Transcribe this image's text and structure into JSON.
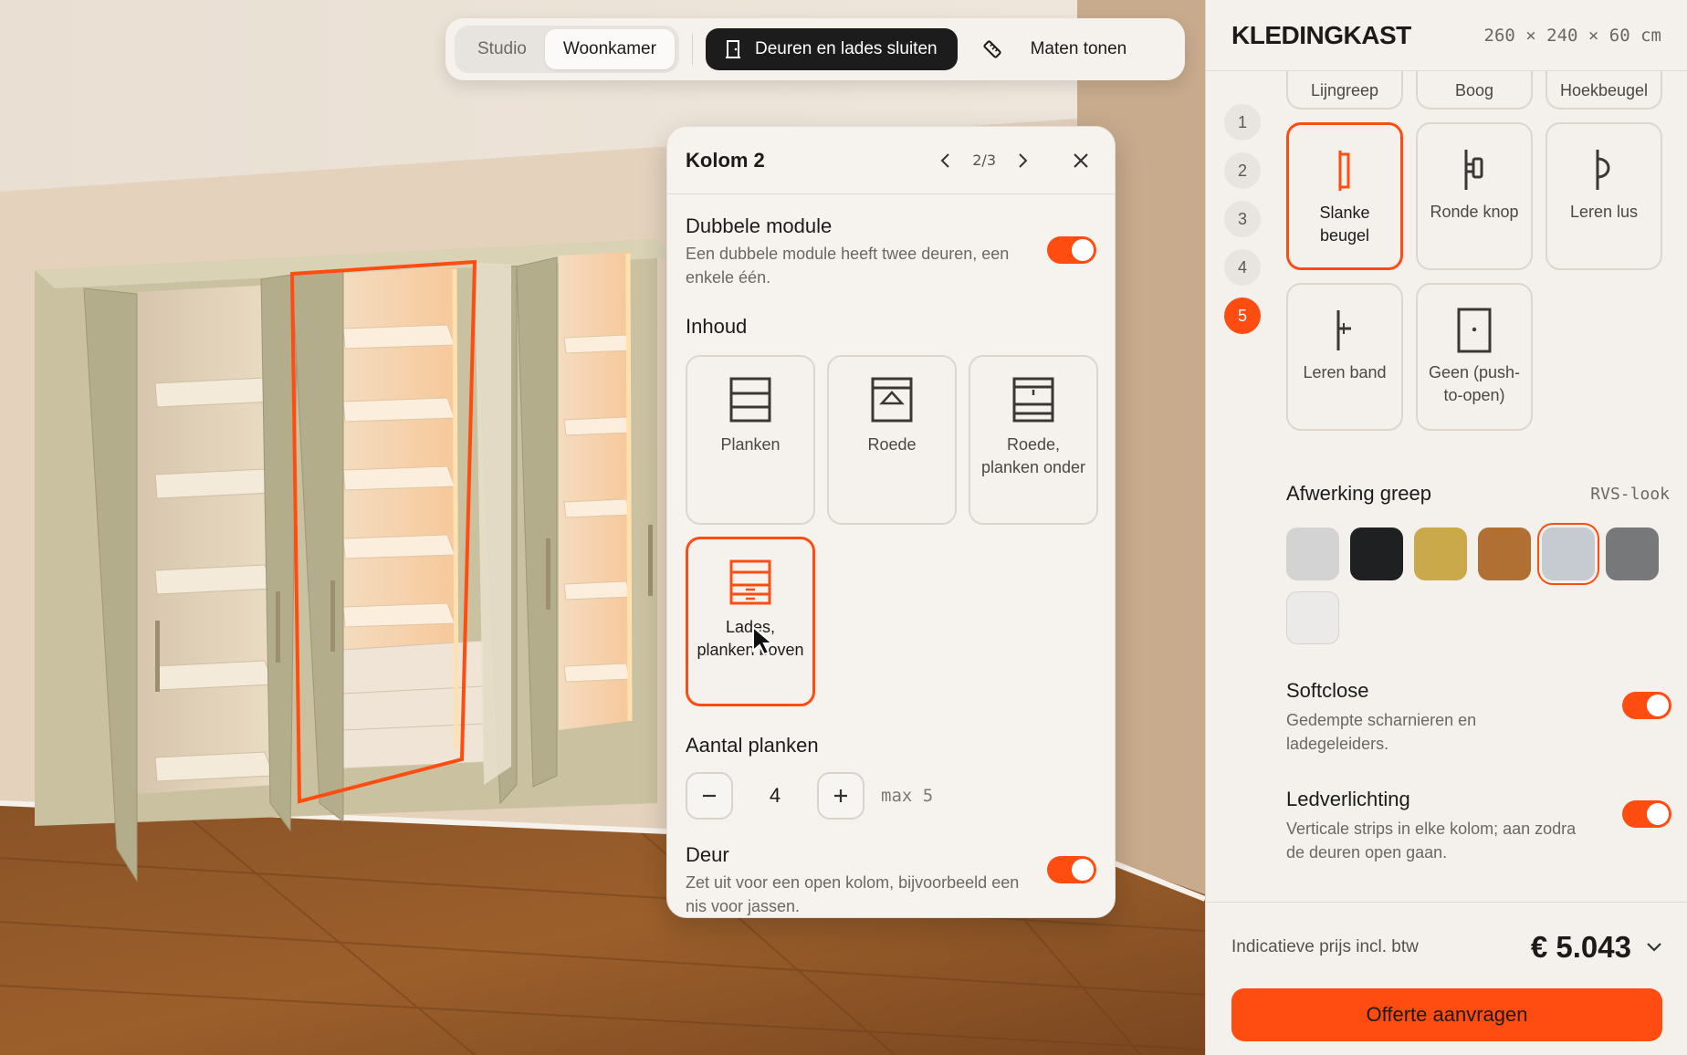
{
  "toolbar": {
    "scenes": [
      {
        "label": "Studio"
      },
      {
        "label": "Woonkamer"
      }
    ],
    "close_doors_label": "Deuren en lades sluiten",
    "measurements_label": "Maten tonen"
  },
  "popup": {
    "title": "Kolom 2",
    "pager": "2/3",
    "double_module": {
      "title": "Dubbele module",
      "description": "Een dubbele module heeft twee deuren, een enkele één.",
      "on": true
    },
    "content_title": "Inhoud",
    "content_options": [
      {
        "label": "Planken"
      },
      {
        "label": "Roede"
      },
      {
        "label": "Roede, planken onder"
      },
      {
        "label": "Lades, planken boven"
      }
    ],
    "content_selected": "Lades, planken boven",
    "shelves": {
      "title": "Aantal planken",
      "value": "4",
      "max": "max 5"
    },
    "door": {
      "title": "Deur",
      "description": "Zet uit voor een open kolom, bijvoorbeeld een nis voor jassen.",
      "on": true
    }
  },
  "panel": {
    "title": "KLEDINGKAST",
    "dimensions": "260 × 240 × 60 cm",
    "steps": [
      "1",
      "2",
      "3",
      "4",
      "5"
    ],
    "active_step": "5",
    "handles_top": [
      {
        "label": "Lijngreep"
      },
      {
        "label": "Boog"
      },
      {
        "label": "Hoekbeugel"
      }
    ],
    "handles": [
      {
        "label": "Slanke beugel",
        "icon": "slim-bar-handle-icon"
      },
      {
        "label": "Ronde knop",
        "icon": "round-knob-icon"
      },
      {
        "label": "Leren lus",
        "icon": "leather-loop-icon"
      },
      {
        "label": "Leren band",
        "icon": "leather-strap-icon"
      },
      {
        "label": "Geen (push-to-open)",
        "icon": "push-to-open-icon"
      }
    ],
    "handle_selected": "Slanke beugel",
    "finish": {
      "title": "Afwerking greep",
      "value": "RVS-look",
      "swatches": [
        "#d3d3d3",
        "#1f2022",
        "#c9a949",
        "#b06f33",
        "#c6cbd1",
        "#777879",
        "#eceae8"
      ],
      "selected_index": 4
    },
    "softclose": {
      "title": "Softclose",
      "description": "Gedempte scharnieren en ladegeleiders.",
      "on": true
    },
    "led": {
      "title": "Ledverlichting",
      "description": "Verticale strips in elke kolom; aan zodra de deuren open gaan.",
      "on": true
    },
    "price_label": "Indicatieve prijs incl. btw",
    "price": "€ 5.043",
    "cta_label": "Offerte aanvragen"
  },
  "colors": {
    "accent": "#ff4c10",
    "dark": "#1c1c1c"
  }
}
